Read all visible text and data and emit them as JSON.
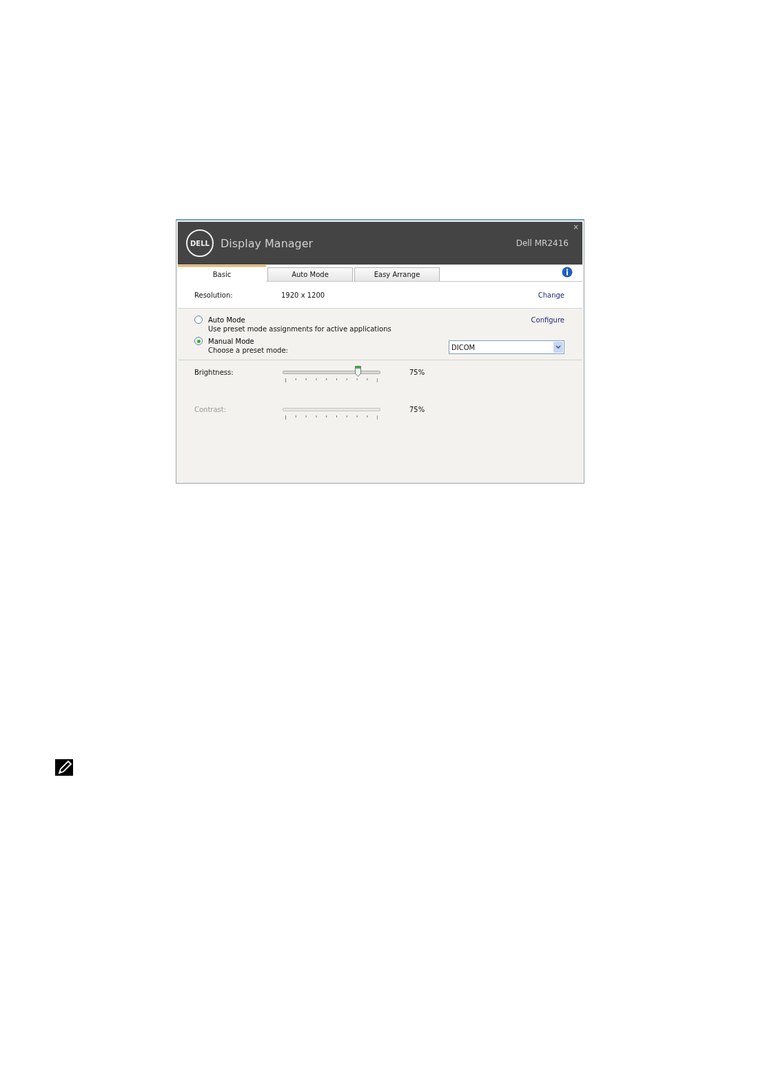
{
  "window": {
    "logo": "DELL",
    "title": "Display Manager",
    "monitor": "Dell MR2416",
    "close": "×"
  },
  "tabs": [
    {
      "label": "Basic",
      "selected": true
    },
    {
      "label": "Auto Mode",
      "selected": false
    },
    {
      "label": "Easy Arrange",
      "selected": false
    }
  ],
  "resolution": {
    "label": "Resolution:",
    "value": "1920 x 1200",
    "link": "Change"
  },
  "modes": [
    {
      "label": "Auto Mode",
      "description": "Use preset mode assignments for active applications",
      "selected": false,
      "link": "Configure"
    },
    {
      "label": "Manual Mode",
      "description": "Choose a preset mode:",
      "selected": true,
      "dropdown": "DICOM"
    }
  ],
  "sliders": [
    {
      "label": "Brightness:",
      "disabled": false,
      "level": 0.75,
      "reading": "75%"
    },
    {
      "label": "Contrast:",
      "disabled": true,
      "reading": "75%"
    }
  ]
}
